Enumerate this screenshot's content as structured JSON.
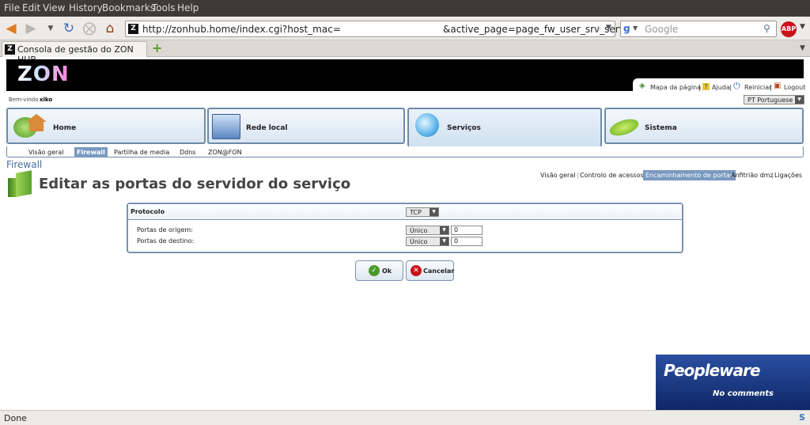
{
  "browser": {
    "menu": [
      "File",
      "Edit",
      "View",
      "History",
      "Bookmarks",
      "Tools",
      "Help"
    ],
    "url": "http://zonhub.home/index.cgi?host_mac=",
    "url_tail": "&active_page=page_fw_user_srv_serv",
    "search_placeholder": "Google",
    "tab_title": "Consola de gestão do ZON HUB",
    "status": "Done",
    "status_s": "S"
  },
  "page": {
    "logo": "ZON",
    "toplinks": [
      "Mapa da página",
      "Ajuda",
      "Reiniciar",
      "Logout"
    ],
    "welcome_prefix": "Bem-vindo",
    "welcome_user": "xiko",
    "language": "PT Portuguese",
    "mainnav": [
      "Home",
      "Rede local",
      "Serviços",
      "Sistema"
    ],
    "subnav": [
      "Visão geral",
      "Firewall",
      "Partilha de media",
      "Ddns",
      "ZON@FON"
    ],
    "section": "Firewall",
    "heading": "Editar as portas do servidor do serviço",
    "sublinks": [
      "Visão geral",
      "Controlo de acessos",
      "Encaminhamento de portas",
      "Anfitrião dmz",
      "Ligações"
    ],
    "form": {
      "protocol_label": "Protocolo",
      "protocol_value": "TCP",
      "src_label": "Portas de origem:",
      "src_mode": "Único",
      "src_value": "0",
      "dst_label": "Portas de destino:",
      "dst_mode": "Único",
      "dst_value": "0"
    },
    "ok_label": "Ok",
    "cancel_label": "Cancelar"
  },
  "ad": {
    "line1": "Peopleware",
    "line2": "No comments"
  },
  "colors": {
    "accent": "#6e8aa8",
    "highlight": "#7a99c0",
    "zon_bar": "#000000"
  }
}
